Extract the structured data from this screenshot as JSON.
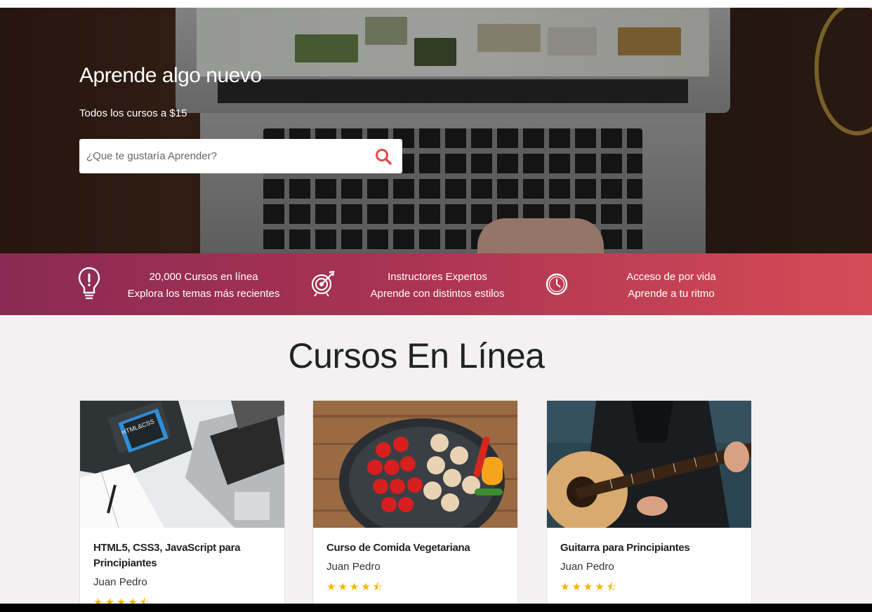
{
  "hero": {
    "title": "Aprende algo nuevo",
    "subtitle": "Todos los cursos a $15",
    "search_placeholder": "¿Que te gustaría Aprender?",
    "search_icon": "search-icon",
    "accent_color": "#e04b4b"
  },
  "features": [
    {
      "icon": "lightbulb-icon",
      "line1": "20,000 Cursos en línea",
      "line2": "Explora los temas más recientes"
    },
    {
      "icon": "target-icon",
      "line1": "Instructores Expertos",
      "line2": "Aprende con distintos estilos"
    },
    {
      "icon": "clock-icon",
      "line1": "Acceso de por vida",
      "line2": "Aprende a tu ritmo"
    }
  ],
  "section": {
    "title": "Cursos En Línea"
  },
  "courses": [
    {
      "title": "HTML5, CSS3, JavaScript para Principiantes",
      "author": "Juan Pedro",
      "stars": "★★★★⯪",
      "rating": 4.5,
      "image": "laptop-notebook-photo"
    },
    {
      "title": "Curso de Comida Vegetariana",
      "author": "Juan Pedro",
      "stars": "★★★★⯪",
      "rating": 4.5,
      "image": "vegetables-pot-photo"
    },
    {
      "title": "Guitarra para Principiantes",
      "author": "Juan Pedro",
      "stars": "★★★★⯪",
      "rating": 4.5,
      "image": "guitar-player-photo"
    }
  ],
  "colors": {
    "banner_start": "#8b2a54",
    "banner_end": "#d64b56",
    "star": "#f4b400",
    "page_background": "#f3f1f2"
  }
}
